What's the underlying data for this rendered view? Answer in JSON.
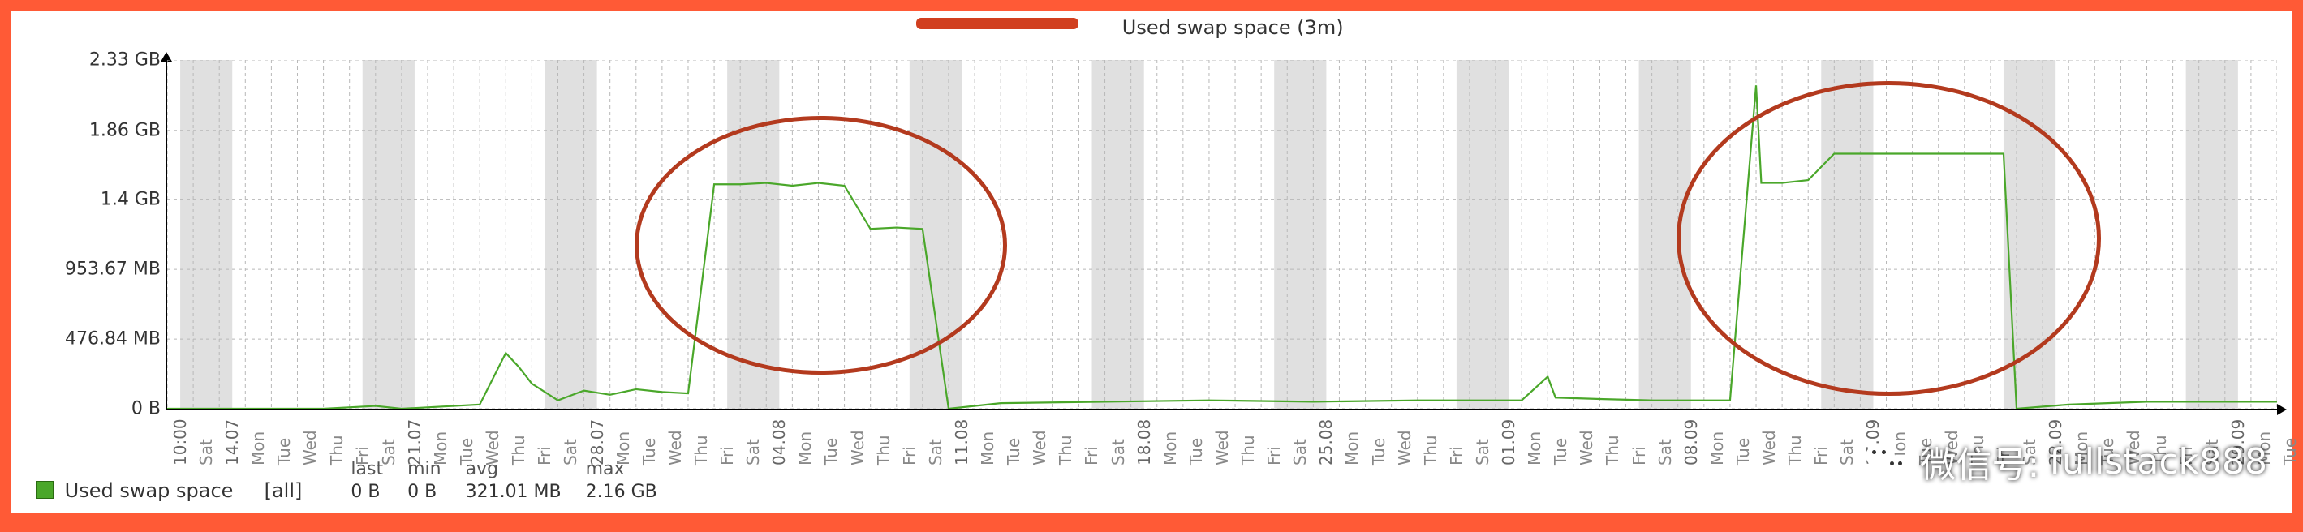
{
  "chart_data": {
    "type": "line",
    "title": "Used swap space  (3m)",
    "xlabel": "",
    "ylabel": "",
    "ylim_bytes": [
      0,
      2501818122
    ],
    "y_ticks": [
      {
        "label": "0 B",
        "bytes": 0
      },
      {
        "label": "476.84 MB",
        "bytes": 500000000
      },
      {
        "label": "953.67 MB",
        "bytes": 1000000000
      },
      {
        "label": "1.4 GB",
        "bytes": 1503238554
      },
      {
        "label": "1.86 GB",
        "bytes": 1997159793
      },
      {
        "label": "2.33 GB",
        "bytes": 2501818122
      }
    ],
    "x_categories": [
      "10:00",
      "Sat",
      "14.07",
      "Mon",
      "Tue",
      "Wed",
      "Thu",
      "Fri",
      "Sat",
      "21.07",
      "Mon",
      "Tue",
      "Wed",
      "Thu",
      "Fri",
      "Sat",
      "28.07",
      "Mon",
      "Tue",
      "Wed",
      "Thu",
      "Fri",
      "Sat",
      "04.08",
      "Mon",
      "Tue",
      "Wed",
      "Thu",
      "Fri",
      "Sat",
      "11.08",
      "Mon",
      "Tue",
      "Wed",
      "Thu",
      "Fri",
      "Sat",
      "18.08",
      "Mon",
      "Tue",
      "Wed",
      "Thu",
      "Fri",
      "Sat",
      "25.08",
      "Mon",
      "Tue",
      "Wed",
      "Thu",
      "Fri",
      "Sat",
      "01.09",
      "Mon",
      "Tue",
      "Wed",
      "Thu",
      "Fri",
      "Sat",
      "08.09",
      "Mon",
      "Tue",
      "Wed",
      "Thu",
      "Fri",
      "Sat",
      "15.09",
      "Mon",
      "Tue",
      "Wed",
      "Thu",
      "Fri",
      "Sat",
      "22.09",
      "Mon",
      "Tue",
      "Wed",
      "Thu",
      "Fri",
      "Sat",
      "29.09",
      "Mon",
      "Tue"
    ],
    "x_major_labels": [
      "10:00",
      "14.07",
      "21.07",
      "28.07",
      "04.08",
      "11.08",
      "18.08",
      "25.08",
      "01.09",
      "08.09",
      "15.09",
      "22.09",
      "29.09"
    ],
    "series": [
      {
        "name": "Used swap space",
        "color": "#4aa72a",
        "data_bytes_by_index": [
          [
            0,
            0
          ],
          [
            6,
            0
          ],
          [
            8,
            20000000
          ],
          [
            9,
            0
          ],
          [
            12,
            30000000
          ],
          [
            13,
            400000000
          ],
          [
            13.5,
            300000000
          ],
          [
            14,
            180000000
          ],
          [
            15,
            60000000
          ],
          [
            16,
            130000000
          ],
          [
            17,
            100000000
          ],
          [
            18,
            140000000
          ],
          [
            19,
            120000000
          ],
          [
            20,
            110000000
          ],
          [
            21,
            1610000000
          ],
          [
            22,
            1610000000
          ],
          [
            23,
            1620000000
          ],
          [
            24,
            1600000000
          ],
          [
            25,
            1620000000
          ],
          [
            26,
            1600000000
          ],
          [
            27,
            1290000000
          ],
          [
            28,
            1300000000
          ],
          [
            29,
            1290000000
          ],
          [
            30,
            0
          ],
          [
            32,
            40000000
          ],
          [
            36,
            50000000
          ],
          [
            40,
            60000000
          ],
          [
            44,
            50000000
          ],
          [
            48,
            60000000
          ],
          [
            51,
            60000000
          ],
          [
            52,
            60000000
          ],
          [
            53,
            230000000
          ],
          [
            53.3,
            80000000
          ],
          [
            55,
            70000000
          ],
          [
            57,
            60000000
          ],
          [
            59,
            60000000
          ],
          [
            60,
            60000000
          ],
          [
            61,
            2320000000
          ],
          [
            61.2,
            1620000000
          ],
          [
            62,
            1620000000
          ],
          [
            63,
            1640000000
          ],
          [
            64,
            1830000000
          ],
          [
            65,
            1830000000
          ],
          [
            66,
            1830000000
          ],
          [
            67,
            1830000000
          ],
          [
            68,
            1830000000
          ],
          [
            69,
            1830000000
          ],
          [
            70,
            1830000000
          ],
          [
            70.5,
            1830000000
          ],
          [
            71,
            0
          ],
          [
            73,
            30000000
          ],
          [
            76,
            50000000
          ],
          [
            79,
            50000000
          ],
          [
            81,
            50000000
          ]
        ]
      }
    ],
    "annotations": [
      {
        "type": "ellipse",
        "center_index": 25,
        "center_bytes": 1200000000,
        "rx_index": 7,
        "ry_bytes": 900000000
      },
      {
        "type": "ellipse",
        "center_index": 66,
        "center_bytes": 1250000000,
        "rx_index": 8,
        "ry_bytes": 1100000000
      }
    ]
  },
  "legend": {
    "name": "Used swap space",
    "scope": "[all]",
    "stats": {
      "last": {
        "label": "last",
        "value": "0 B"
      },
      "min": {
        "label": "min",
        "value": "0 B"
      },
      "avg": {
        "label": "avg",
        "value": "321.01 MB"
      },
      "max": {
        "label": "max",
        "value": "2.16 GB"
      }
    }
  },
  "watermark": {
    "prefix": "微信号:",
    "value": "fullstack888"
  },
  "colors": {
    "bg": "#ff5a36",
    "series": "#4aa72a",
    "annotation": "#b33a1e"
  }
}
